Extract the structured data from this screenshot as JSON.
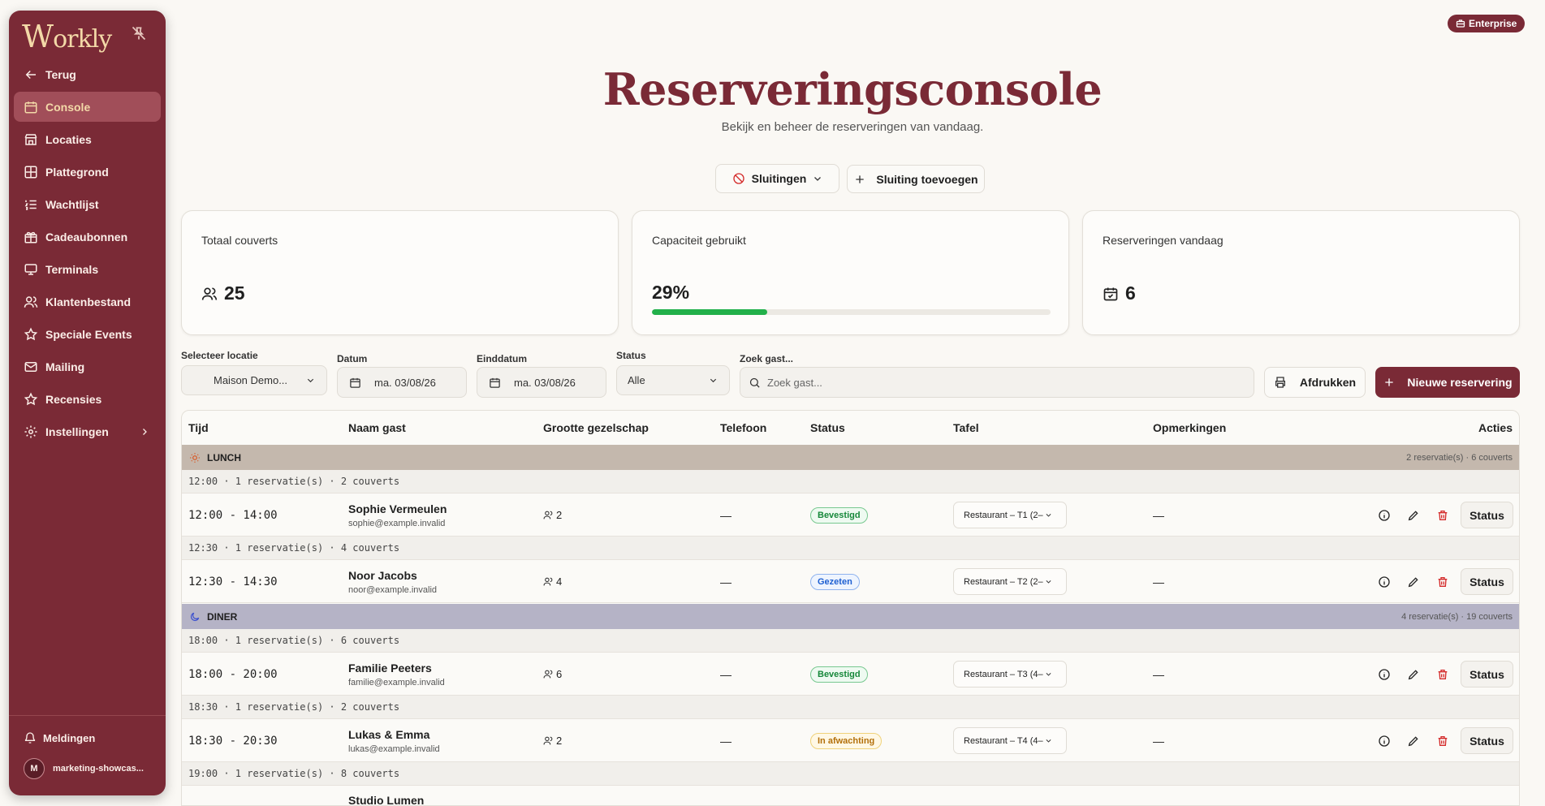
{
  "sidebar": {
    "logo": "Workly",
    "items": [
      {
        "label": "Terug"
      },
      {
        "label": "Console"
      },
      {
        "label": "Locaties"
      },
      {
        "label": "Plattegrond"
      },
      {
        "label": "Wachtlijst"
      },
      {
        "label": "Cadeaubonnen"
      },
      {
        "label": "Terminals"
      },
      {
        "label": "Klantenbestand"
      },
      {
        "label": "Speciale Events"
      },
      {
        "label": "Mailing"
      },
      {
        "label": "Recensies"
      },
      {
        "label": "Instellingen"
      }
    ],
    "notifications": "Meldingen",
    "user_initial": "M",
    "user_name": "marketing-showcas..."
  },
  "header": {
    "badge": "Enterprise",
    "title": "Reserveringsconsole",
    "subtitle": "Bekijk en beheer de reserveringen van vandaag.",
    "closures_button": "Sluitingen",
    "add_closure_button": "Sluiting toevoegen"
  },
  "stats": {
    "covers_label": "Totaal couverts",
    "covers_value": "25",
    "capacity_label": "Capaciteit gebruikt",
    "capacity_value": "29%",
    "capacity_fraction": 0.29,
    "today_label": "Reserveringen vandaag",
    "today_value": "6"
  },
  "filters": {
    "location_label": "Selecteer locatie",
    "location_value": "Maison Demo...",
    "date_label": "Datum",
    "date_value": "ma. 03/08/26",
    "enddate_label": "Einddatum",
    "enddate_value": "ma. 03/08/26",
    "status_label": "Status",
    "status_value": "Alle",
    "search_label": "Zoek gast...",
    "search_placeholder": "Zoek gast...",
    "print_button": "Afdrukken",
    "new_button": "Nieuwe reservering"
  },
  "table": {
    "headers": [
      "Tijd",
      "Naam gast",
      "Grootte gezelschap",
      "Telefoon",
      "Status",
      "Tafel",
      "Opmerkingen",
      "Acties"
    ],
    "lunch": {
      "name": "LUNCH",
      "summary": "2 reservatie(s) · 6 couverts"
    },
    "diner": {
      "name": "DINER",
      "summary": "4 reservatie(s) · 19 couverts"
    },
    "slots": [
      "12:00  ·  1 reservatie(s) · 2 couverts",
      "12:30  ·  1 reservatie(s) · 4 couverts",
      "18:00  ·  1 reservatie(s) · 6 couverts",
      "18:30  ·  1 reservatie(s) · 2 couverts",
      "19:00  ·  1 reservatie(s) · 8 couverts"
    ],
    "rows": [
      {
        "time": "12:00 - 14:00",
        "name": "Sophie Vermeulen",
        "email": "sophie@example.invalid",
        "size": "2",
        "phone": "—",
        "status": "Bevestigd",
        "table": "Restaurant – T1 (2–",
        "remarks": "—",
        "action": "Status"
      },
      {
        "time": "12:30 - 14:30",
        "name": "Noor Jacobs",
        "email": "noor@example.invalid",
        "size": "4",
        "phone": "—",
        "status": "Gezeten",
        "table": "Restaurant – T2 (2–",
        "remarks": "—",
        "action": "Status"
      },
      {
        "time": "18:00 - 20:00",
        "name": "Familie Peeters",
        "email": "familie@example.invalid",
        "size": "6",
        "phone": "—",
        "status": "Bevestigd",
        "table": "Restaurant – T3 (4–",
        "remarks": "—",
        "action": "Status"
      },
      {
        "time": "18:30 - 20:30",
        "name": "Lukas & Emma",
        "email": "lukas@example.invalid",
        "size": "2",
        "phone": "—",
        "status": "In afwachting",
        "table": "Restaurant – T4 (4–",
        "remarks": "—",
        "action": "Status"
      },
      {
        "name": "Studio Lumen"
      }
    ]
  },
  "colors": {
    "brand": "#7a2a36",
    "accent": "#f3d9a8",
    "progress": "#22b04a",
    "lunch_band": "#c4b8ad",
    "diner_band": "#b5b3c6"
  }
}
